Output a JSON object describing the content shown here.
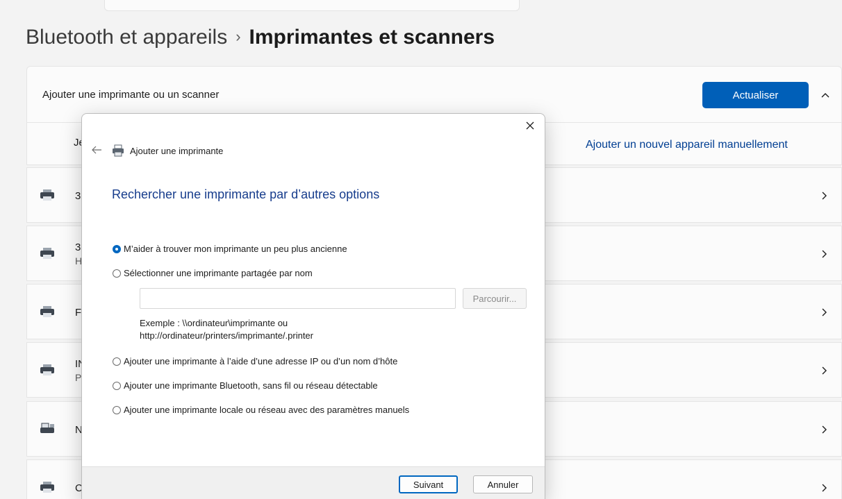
{
  "breadcrumb": {
    "parent": "Bluetooth et appareils",
    "separator": "›",
    "current": "Imprimantes et scanners"
  },
  "add_section": {
    "label": "Ajouter une imprimante ou un scanner",
    "refresh_button": "Actualiser",
    "row2_fragment": "Je",
    "manual_link": "Ajouter un nouvel appareil manuellement"
  },
  "printers": [
    {
      "name_fragment": "3",
      "sub_fragment": ""
    },
    {
      "name_fragment": "3",
      "sub_fragment": "H"
    },
    {
      "name_fragment": "F",
      "sub_fragment": ""
    },
    {
      "name_fragment": "IN",
      "sub_fragment": "P"
    },
    {
      "name_fragment": "N",
      "sub_fragment": ""
    },
    {
      "name_fragment": "C",
      "sub_fragment": ""
    }
  ],
  "dialog": {
    "title": "Ajouter une imprimante",
    "heading": "Rechercher une imprimante par d’autres options",
    "options": [
      {
        "label": "M’aider à trouver mon imprimante un peu plus ancienne",
        "checked": true
      },
      {
        "label": "Sélectionner une imprimante partagée par nom",
        "checked": false
      },
      {
        "label": "Ajouter une imprimante à l’aide d’une adresse IP ou d’un nom d’hôte",
        "checked": false
      },
      {
        "label": "Ajouter une imprimante Bluetooth, sans fil ou réseau détectable",
        "checked": false
      },
      {
        "label": "Ajouter une imprimante locale ou réseau avec des paramètres manuels",
        "checked": false
      }
    ],
    "share_input_value": "",
    "browse_button": "Parcourir...",
    "example_line1": "Exemple : \\\\ordinateur\\imprimante ou",
    "example_line2": "http://ordinateur/printers/imprimante/.printer",
    "next_button": "Suivant",
    "cancel_button": "Annuler"
  },
  "colors": {
    "accent": "#005fb8",
    "heading": "#163c8c",
    "link": "#003e92",
    "background": "#f3f3f3",
    "card": "#fbfbfb"
  },
  "icons": [
    "back-arrow-icon",
    "printer-icon",
    "close-icon",
    "chevron-up-icon",
    "chevron-right-icon"
  ]
}
